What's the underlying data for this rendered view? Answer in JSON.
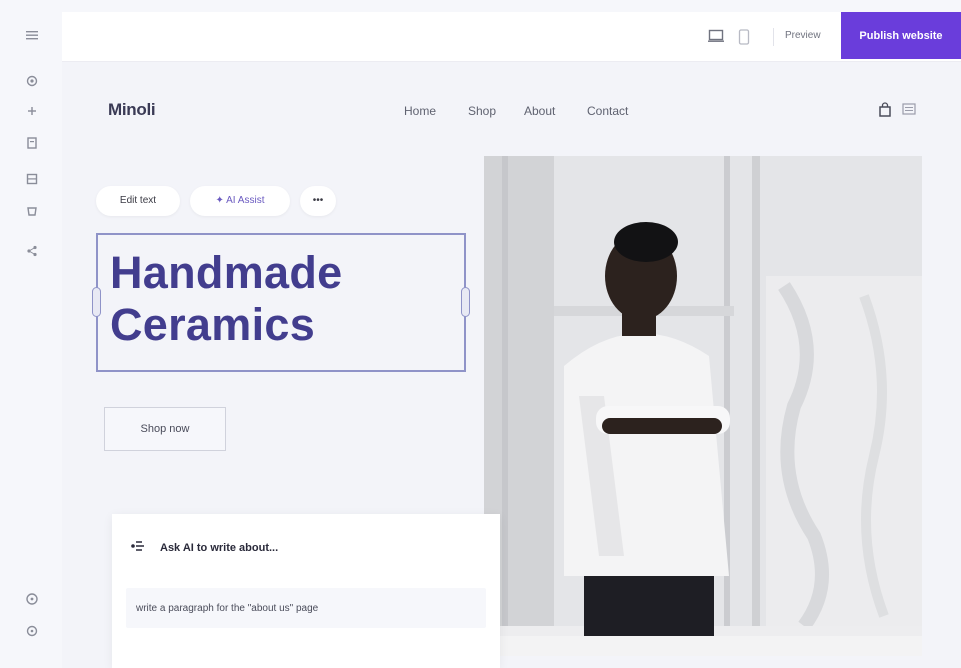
{
  "rail": {
    "icons": [
      "menu-icon",
      "settings-icon",
      "plus-icon",
      "pages-icon",
      "layers-icon",
      "shop-icon",
      "share-icon",
      "help-icon",
      "gear-icon"
    ]
  },
  "topbar": {
    "preview_label": "Preview",
    "publish_label": "Publish website",
    "device_icons": [
      "desktop-icon",
      "mobile-icon"
    ]
  },
  "site": {
    "brand": "Minoli",
    "nav": [
      "Home",
      "Shop",
      "About",
      "Contact"
    ],
    "header_icons": [
      "cart-icon",
      "menu-icon"
    ],
    "toolbar": {
      "edit_text": "Edit text",
      "ai_assist": "AI Assist",
      "more": "•••"
    },
    "headline_line1": "Handmade",
    "headline_line2": "Ceramics",
    "cta_label": "Shop now"
  },
  "ai_card": {
    "title": "Ask AI to write about...",
    "prompt_value": "write a paragraph for the \"about us\" page"
  },
  "colors": {
    "accent": "#6a3ddb",
    "headline": "#423d8e",
    "selection": "#8f93c8"
  }
}
